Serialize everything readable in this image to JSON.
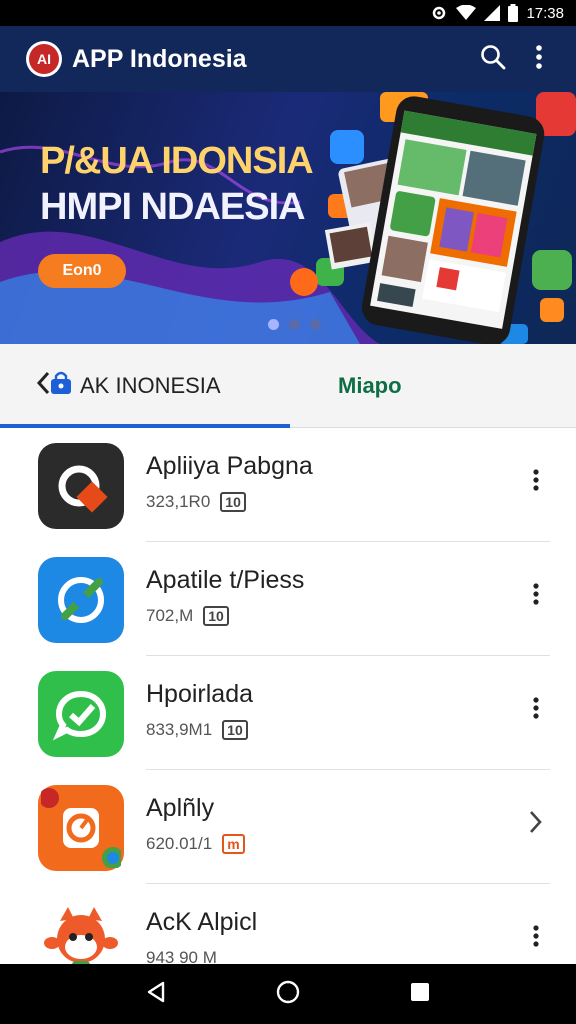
{
  "status_bar": {
    "time": "17:38"
  },
  "app_bar": {
    "logo_text": "AI",
    "title": "APP Indonesia"
  },
  "banner": {
    "headline_line1": "P/&UA IDONSIA",
    "headline_line2": "HMPI NDAESIA",
    "cta_label": "Eon0",
    "active_dot": 0
  },
  "tabs": [
    {
      "label": "AK INONESIA",
      "selected": true
    },
    {
      "label": "Miapo",
      "selected": false
    }
  ],
  "apps": [
    {
      "name": "Apliiya Pabgna",
      "size": "323,1R0",
      "badge": "10",
      "action": "more",
      "icon": "camera-app-icon"
    },
    {
      "name": "Apatile t/Piess",
      "size": "702,M",
      "badge": "10",
      "action": "more",
      "icon": "link-app-icon"
    },
    {
      "name": "Hpoirlada",
      "size": "833,9M1",
      "badge": "10",
      "action": "more",
      "icon": "chat-app-icon"
    },
    {
      "name": "Aplñly",
      "size": "620.01/1",
      "badge": "m",
      "action": "open",
      "icon": "timer-app-icon"
    },
    {
      "name": "AcK Alpicl",
      "size": "943 90 M",
      "badge": "",
      "action": "more",
      "icon": "mascot-app-icon"
    }
  ],
  "colors": {
    "app_bar": "#12285a",
    "accent_orange": "#f57c1f",
    "tab_indicator": "#1d5fd6",
    "tab_secondary": "#0e6e45"
  }
}
